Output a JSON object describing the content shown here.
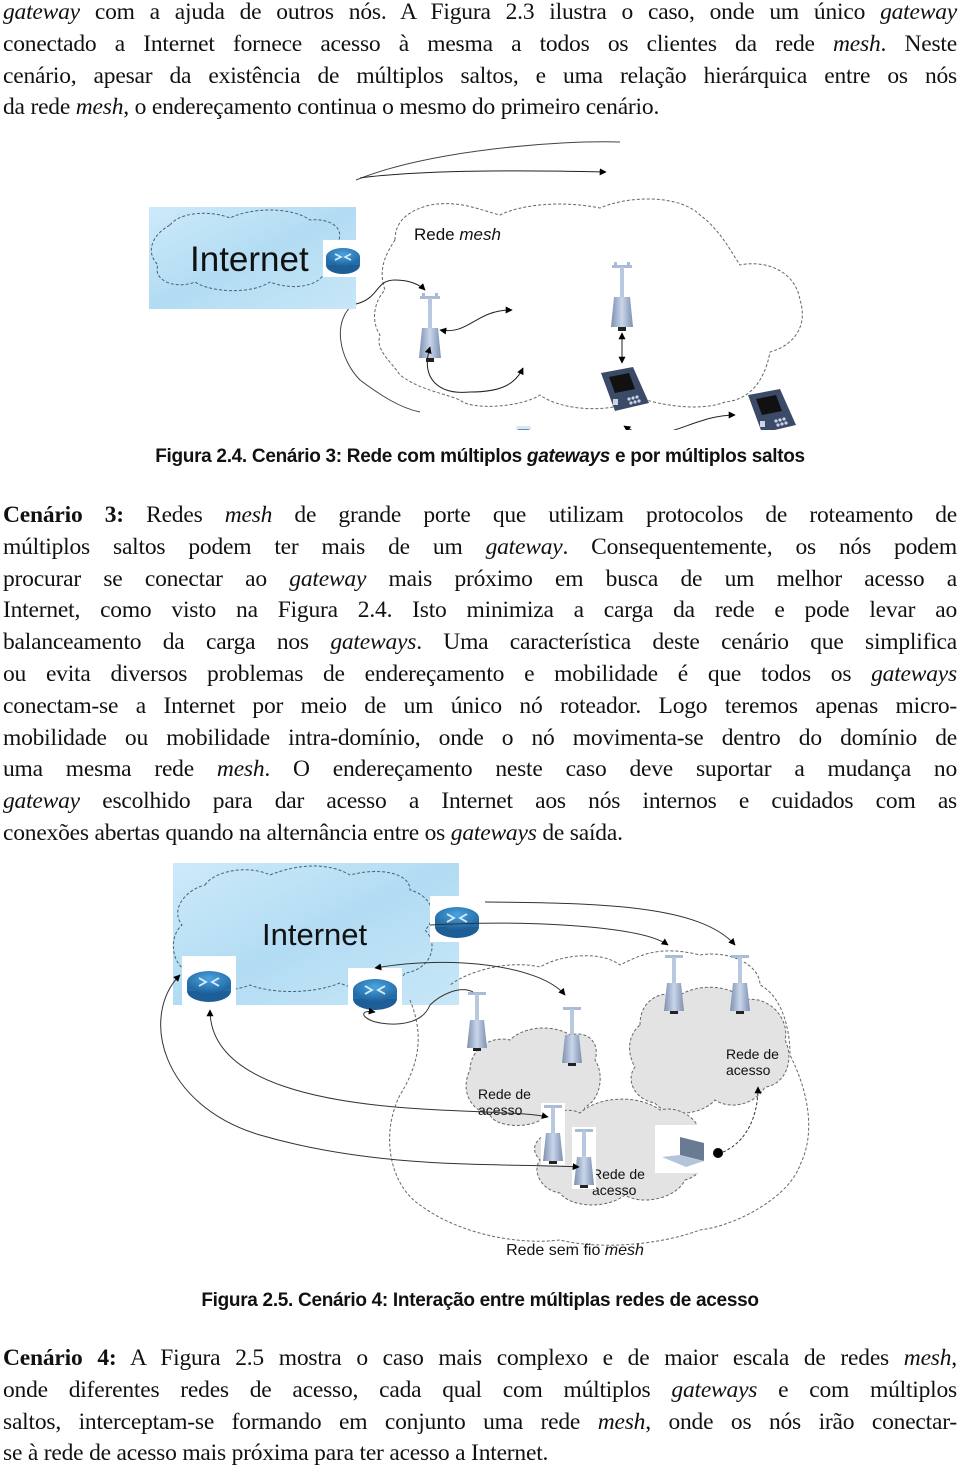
{
  "intro_paragraph": {
    "lines": [
      [
        {
          "t": "gateway",
          "i": true
        },
        {
          "t": " com a ajuda de outros nós. A Figura 2.3 ilustra o caso, onde um único "
        },
        {
          "t": "gateway",
          "i": true
        }
      ],
      [
        {
          "t": "conectado a Internet fornece acesso à mesma a todos os clientes da rede "
        },
        {
          "t": "mesh",
          "i": true
        },
        {
          "t": ". Neste"
        }
      ],
      [
        {
          "t": "cenário, apesar da existência de múltiplos saltos, e uma relação hierárquica entre os nós"
        }
      ],
      [
        {
          "t": "da rede "
        },
        {
          "t": "mesh",
          "i": true
        },
        {
          "t": ", o endereçamento continua o mesmo do primeiro cenário."
        }
      ]
    ]
  },
  "figure_2_4": {
    "internet_label": "Internet",
    "network_label_prefix": "Rede ",
    "network_label_italic": "mesh",
    "caption_prefix": "Figura 2.4. Cenário 3: Rede com múltiplos ",
    "caption_italic": "gateways",
    "caption_suffix": " e por múltiplos saltos"
  },
  "scenario_3": {
    "lines": [
      [
        {
          "t": "Cenário 3:",
          "b": true
        },
        {
          "t": "  Redes "
        },
        {
          "t": "mesh",
          "i": true
        },
        {
          "t": " de grande porte que utilizam protocolos de roteamento de"
        }
      ],
      [
        {
          "t": "múltiplos saltos podem ter mais de um "
        },
        {
          "t": "gateway",
          "i": true
        },
        {
          "t": ". Consequentemente, os nós podem"
        }
      ],
      [
        {
          "t": "procurar se conectar ao "
        },
        {
          "t": "gateway",
          "i": true
        },
        {
          "t": " mais próximo em busca de um melhor acesso a"
        }
      ],
      [
        {
          "t": "Internet,  como visto na Figura 2.4. Isto minimiza a carga da rede e pode levar ao"
        }
      ],
      [
        {
          "t": "balanceamento da carga nos "
        },
        {
          "t": "gateways",
          "i": true
        },
        {
          "t": ". Uma característica deste cenário que simplifica"
        }
      ],
      [
        {
          "t": "ou evita diversos problemas de endereçamento e mobilidade é que todos os "
        },
        {
          "t": "gateways",
          "i": true
        }
      ],
      [
        {
          "t": "conectam-se a Internet por meio de um único nó roteador. Logo teremos apenas micro-"
        }
      ],
      [
        {
          "t": "mobilidade ou mobilidade intra-domínio, onde o nó movimenta-se dentro do domínio de"
        }
      ],
      [
        {
          "t": "uma mesma rede "
        },
        {
          "t": "mesh",
          "i": true
        },
        {
          "t": ". O endereçamento neste caso deve suportar a mudança no"
        }
      ],
      [
        {
          "t": "gateway",
          "i": true
        },
        {
          "t": " escolhido para dar acesso a Internet aos nós internos e cuidados com as"
        }
      ],
      [
        {
          "t": "conexões abertas quando na alternância entre os "
        },
        {
          "t": "gateways",
          "i": true
        },
        {
          "t": " de saída."
        }
      ]
    ]
  },
  "figure_2_5": {
    "internet_label": "Internet",
    "access_network_line1": "Rede de",
    "access_network_line2": "acesso",
    "mesh_label_prefix": "Rede sem fio ",
    "mesh_label_italic": "mesh",
    "caption": "Figura 2.5. Cenário 4: Interação entre múltiplas redes de acesso"
  },
  "scenario_4": {
    "lines": [
      [
        {
          "t": "Cenário 4:",
          "b": true
        },
        {
          "t": " A Figura 2.5 mostra o caso mais complexo e de maior escala de redes "
        },
        {
          "t": "mesh",
          "i": true
        },
        {
          "t": ","
        }
      ],
      [
        {
          "t": "onde diferentes redes de acesso, cada qual com múltiplos "
        },
        {
          "t": "gateways",
          "i": true
        },
        {
          "t": " e com múltiplos"
        }
      ],
      [
        {
          "t": "saltos, interceptam-se formando em conjunto uma rede "
        },
        {
          "t": "mesh",
          "i": true
        },
        {
          "t": ", onde os nós irão conectar-"
        }
      ],
      [
        {
          "t": "se à rede de acesso mais próxima para ter acesso a Internet."
        }
      ]
    ]
  },
  "colors": {
    "internet_cloud": "#bfe3f6",
    "router": "#2b7fbf",
    "access_cloud": "#e3e3e3",
    "device": "#9fb3cf"
  }
}
